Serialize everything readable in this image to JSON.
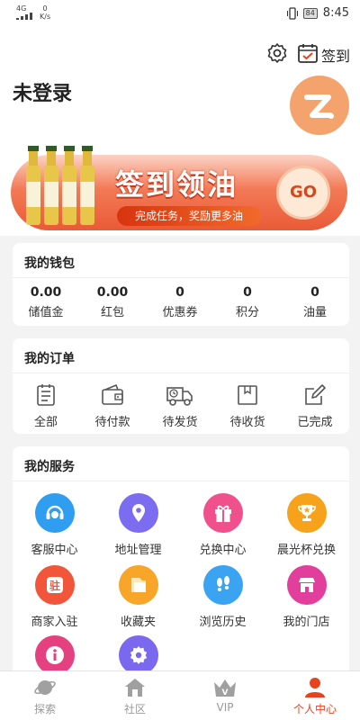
{
  "status_bar": {
    "signal": "4G",
    "net_speed": "0",
    "net_unit": "K/s",
    "battery": "84",
    "time": "8:45"
  },
  "header": {
    "settings_icon": "gear-icon",
    "checkin_icon": "calendar-check-icon",
    "checkin_label": "签到",
    "login_status": "未登录"
  },
  "banner": {
    "title": "签到领油",
    "subtitle": "完成任务，奖励更多油",
    "go_label": "GO"
  },
  "wallet": {
    "title": "我的钱包",
    "items": [
      {
        "value": "0.00",
        "label": "储值金"
      },
      {
        "value": "0.00",
        "label": "红包"
      },
      {
        "value": "0",
        "label": "优惠券"
      },
      {
        "value": "0",
        "label": "积分"
      },
      {
        "value": "0",
        "label": "油量"
      }
    ]
  },
  "orders": {
    "title": "我的订单",
    "items": [
      {
        "label": "全部",
        "icon": "list-icon"
      },
      {
        "label": "待付款",
        "icon": "wallet-icon"
      },
      {
        "label": "待发货",
        "icon": "truck-icon"
      },
      {
        "label": "待收货",
        "icon": "box-icon"
      },
      {
        "label": "已完成",
        "icon": "edit-icon"
      }
    ]
  },
  "services": {
    "title": "我的服务",
    "items": [
      {
        "label": "客服中心",
        "icon": "headset-icon",
        "color": "#2f9df0"
      },
      {
        "label": "地址管理",
        "icon": "location-icon",
        "color": "#7b6cf0"
      },
      {
        "label": "兑换中心",
        "icon": "gift-icon",
        "color": "#f0508c"
      },
      {
        "label": "晨光杯兑换",
        "icon": "trophy-icon",
        "color": "#f6a21b"
      },
      {
        "label": "商家入驻",
        "icon": "store-badge-icon",
        "color": "#f2563a"
      },
      {
        "label": "收藏夹",
        "icon": "folder-icon",
        "color": "#f7a62a"
      },
      {
        "label": "浏览历史",
        "icon": "footprints-icon",
        "color": "#3aa3f2"
      },
      {
        "label": "我的门店",
        "icon": "shop-icon",
        "color": "#e23f9c"
      },
      {
        "label": "",
        "icon": "info-icon",
        "color": "#e5407f"
      },
      {
        "label": "",
        "icon": "settings-gear-icon",
        "color": "#7a68ee"
      }
    ]
  },
  "tabbar": {
    "items": [
      {
        "label": "探索",
        "icon": "planet-icon"
      },
      {
        "label": "社区",
        "icon": "home-icon"
      },
      {
        "label": "VIP",
        "icon": "crown-icon"
      },
      {
        "label": "个人中心",
        "icon": "person-icon"
      }
    ],
    "active_color": "#e8421d"
  }
}
